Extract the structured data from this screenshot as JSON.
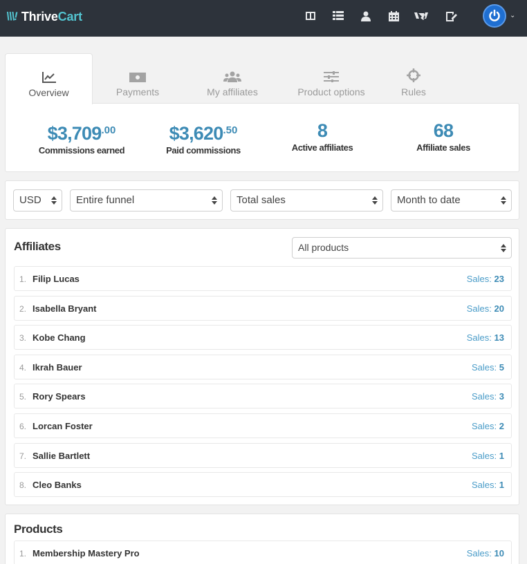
{
  "app": {
    "logo_prefix": "Thrive",
    "logo_accent": "Cart",
    "logo_mark": "\\\\\\!"
  },
  "topnav": {
    "icons": [
      "dashboard-icon",
      "list-icon",
      "user-icon",
      "calendar-icon",
      "handshake-icon",
      "edit-icon"
    ],
    "power_icon": "power-icon"
  },
  "tabs": [
    {
      "label": "Overview",
      "icon": "chart-icon",
      "active": true
    },
    {
      "label": "Payments",
      "icon": "money-icon"
    },
    {
      "label": "My affiliates",
      "icon": "users-icon"
    },
    {
      "label": "Product options",
      "icon": "sliders-icon"
    },
    {
      "label": "Rules",
      "icon": "crosshair-icon"
    }
  ],
  "stats": [
    {
      "value_main": "$3,709",
      "value_cents": ".00",
      "label": "Commissions earned"
    },
    {
      "value_main": "$3,620",
      "value_cents": ".50",
      "label": "Paid commissions"
    },
    {
      "value_main": "8",
      "value_cents": "",
      "label": "Active affiliates"
    },
    {
      "value_main": "68",
      "value_cents": "",
      "label": "Affiliate sales"
    }
  ],
  "filters": {
    "currency": "USD",
    "funnel": "Entire funnel",
    "metric": "Total sales",
    "period": "Month to date"
  },
  "affiliates": {
    "title": "Affiliates",
    "product_filter": "All products",
    "sales_label": "Sales:",
    "rows": [
      {
        "num": "1.",
        "name": "Filip Lucas",
        "sales": "23"
      },
      {
        "num": "2.",
        "name": "Isabella Bryant",
        "sales": "20"
      },
      {
        "num": "3.",
        "name": "Kobe Chang",
        "sales": "13"
      },
      {
        "num": "4.",
        "name": "Ikrah Bauer",
        "sales": "5"
      },
      {
        "num": "5.",
        "name": "Rory Spears",
        "sales": "3"
      },
      {
        "num": "6.",
        "name": "Lorcan Foster",
        "sales": "2"
      },
      {
        "num": "7.",
        "name": "Sallie Bartlett",
        "sales": "1"
      },
      {
        "num": "8.",
        "name": "Cleo Banks",
        "sales": "1"
      }
    ]
  },
  "products": {
    "title": "Products",
    "sales_label": "Sales:",
    "rows": [
      {
        "num": "1.",
        "name": "Membership Mastery Pro",
        "sales": "10"
      }
    ]
  },
  "colors": {
    "accent": "#3d8bb5",
    "topbar": "#2d333b",
    "logo": "#53c4d0"
  }
}
